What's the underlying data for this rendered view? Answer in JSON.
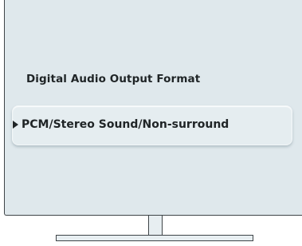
{
  "setting": {
    "title": "Digital Audio Output Format"
  },
  "option": {
    "selected_label": "PCM/Stereo Sound/Non-surround",
    "pointer_icon": "triangle-right-icon"
  },
  "colors": {
    "screen_background": "#dfe8ec",
    "text": "#1f2426",
    "frame": "#3e4448"
  }
}
